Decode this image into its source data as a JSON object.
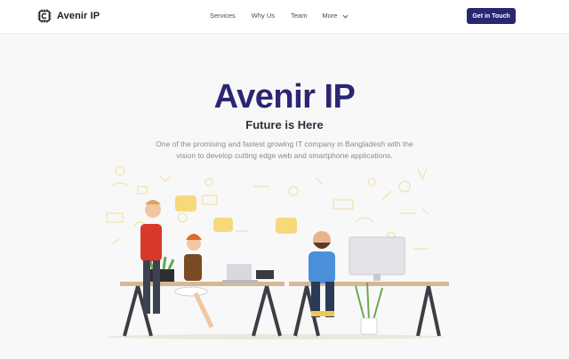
{
  "brand": {
    "name": "Avenir IP",
    "logo_icon": "chip-c-logo-icon"
  },
  "nav": {
    "items": [
      {
        "label": "Services"
      },
      {
        "label": "Why Us"
      },
      {
        "label": "Team"
      },
      {
        "label": "More",
        "icon": "chevron-down-icon"
      }
    ]
  },
  "cta": {
    "label": "Get in Touch",
    "color": "#2b2673"
  },
  "hero": {
    "title": "Avenir IP",
    "subtitle": "Future is Here",
    "description": "One of the promising and fastest growing IT company in Bangladesh with the vision to develop cutting edge web and smartphone applications."
  },
  "colors": {
    "primary": "#2b2673",
    "background": "#f8f8f9",
    "muted_text": "#8a8a93"
  }
}
